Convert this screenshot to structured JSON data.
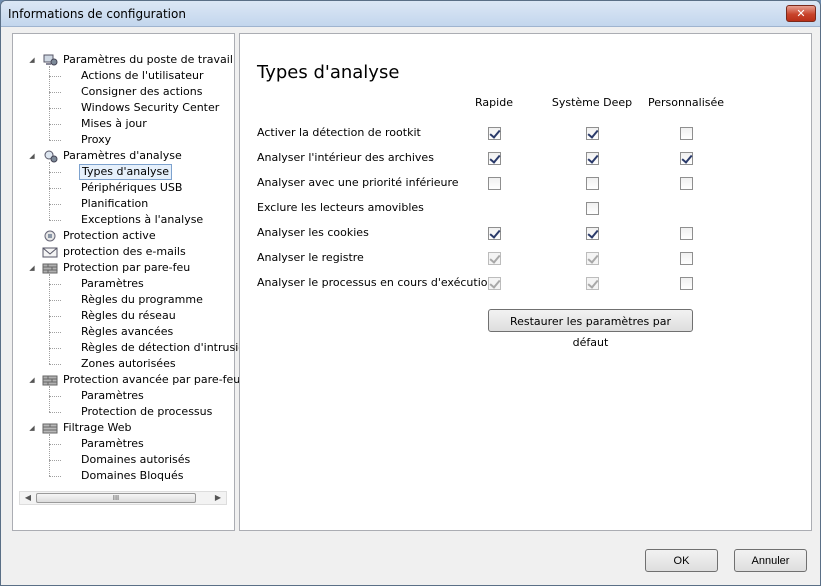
{
  "window": {
    "title": "Informations de configuration"
  },
  "tree": {
    "groups": [
      {
        "label": "Paramètres du poste de travail",
        "icon": "computer-settings-icon",
        "children": [
          "Actions de l'utilisateur",
          "Consigner des actions",
          "Windows Security Center",
          "Mises à jour",
          "Proxy"
        ]
      },
      {
        "label": "Paramètres d'analyse",
        "icon": "scan-settings-icon",
        "children": [
          "Types d'analyse",
          "Périphériques USB",
          "Planification",
          "Exceptions à l'analyse"
        ]
      },
      {
        "label": "Protection active",
        "icon": "active-protection-icon",
        "children": []
      },
      {
        "label": "protection des e-mails",
        "icon": "email-icon",
        "children": []
      },
      {
        "label": "Protection par pare-feu",
        "icon": "firewall-icon",
        "children": [
          "Paramètres",
          "Règles du programme",
          "Règles du réseau",
          "Règles avancées",
          "Règles de détection d'intrusion",
          "Zones autorisées"
        ]
      },
      {
        "label": "Protection avancée par pare-feu",
        "icon": "firewall-icon",
        "children": [
          "Paramètres",
          "Protection de processus"
        ]
      },
      {
        "label": "Filtrage Web",
        "icon": "web-filter-icon",
        "children": [
          "Paramètres",
          "Domaines autorisés",
          "Domaines Bloqués"
        ]
      }
    ],
    "selected": "Types d'analyse",
    "scrollbar": {
      "thumb_grip": "III",
      "left_arrow": "◀",
      "right_arrow": "▶"
    }
  },
  "main": {
    "title": "Types d'analyse",
    "columns": [
      "Rapide",
      "Système Deep",
      "Personnalisée"
    ],
    "rows": [
      {
        "label": "Activer la détection de rootkit",
        "cells": [
          {
            "checked": true
          },
          {
            "checked": true
          },
          {
            "checked": false
          }
        ]
      },
      {
        "label": "Analyser l'intérieur des archives",
        "cells": [
          {
            "checked": true
          },
          {
            "checked": true
          },
          {
            "checked": true
          }
        ]
      },
      {
        "label": "Analyser avec une priorité inférieure",
        "cells": [
          {
            "checked": false
          },
          {
            "checked": false
          },
          {
            "checked": false
          }
        ]
      },
      {
        "label": "Exclure les lecteurs amovibles",
        "cells": [
          null,
          {
            "checked": false
          },
          null
        ]
      },
      {
        "label": "Analyser les cookies",
        "cells": [
          {
            "checked": true
          },
          {
            "checked": true
          },
          {
            "checked": false
          }
        ]
      },
      {
        "label": "Analyser le registre",
        "cells": [
          {
            "checked": true,
            "disabled": true
          },
          {
            "checked": true,
            "disabled": true
          },
          {
            "checked": false
          }
        ]
      },
      {
        "label": "Analyser le processus en cours d'exécution",
        "cells": [
          {
            "checked": true,
            "disabled": true
          },
          {
            "checked": true,
            "disabled": true
          },
          {
            "checked": false
          }
        ]
      }
    ],
    "restore_button": "Restaurer les paramètres par défaut"
  },
  "footer": {
    "ok": "OK",
    "cancel": "Annuler"
  }
}
